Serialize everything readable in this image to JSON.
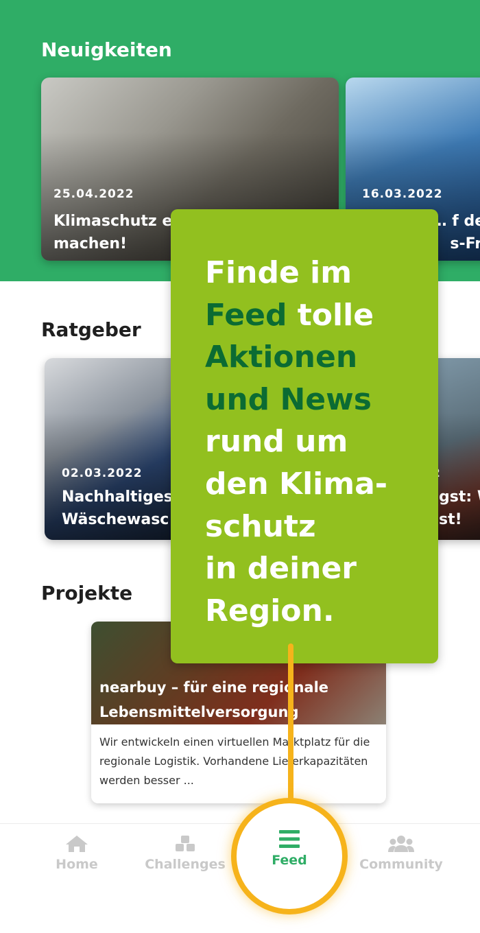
{
  "sections": {
    "news_title": "Neuigkeiten",
    "guide_title": "Ratgeber",
    "projects_title": "Projekte"
  },
  "news": [
    {
      "date": "25.04.2022",
      "headline_line1": "Klimaschutz e",
      "headline_line2": "machen!"
    },
    {
      "date": "16.03.2022",
      "headline_line1": "… f der",
      "headline_line2": "s-Fre"
    }
  ],
  "guide": [
    {
      "date": "02.03.2022",
      "headline_line1": "Nachhaltiges",
      "headline_line2": "Wäschewasc"
    },
    {
      "date": "2",
      "headline_line1": "gst: W",
      "headline_line2": "st!"
    }
  ],
  "project": {
    "title": "nearbuy – für eine regionale Lebensmittelversorgung",
    "description": "Wir entwickeln einen virtuellen Marktplatz für die regionale Logistik. Vorhandene Lieferkapazitäten werden besser ..."
  },
  "tooltip": {
    "line1": "Finde im",
    "feed_word": "Feed",
    "line2_rest": " tolle",
    "line3": "Aktionen",
    "line4": "und News",
    "line5": "rund um",
    "line6": "den Klima-",
    "line7": "schutz",
    "line8": "in deiner",
    "line9": "Region."
  },
  "nav": {
    "home": "Home",
    "challenges": "Challenges",
    "feed": "Feed",
    "community": "Community"
  },
  "icons": {
    "home": "home-icon",
    "challenges": "cubes-icon",
    "feed": "menu-icon",
    "community": "users-icon"
  },
  "colors": {
    "header_green": "#2fad66",
    "tooltip_green": "#92c01f",
    "highlight_green": "#0b6b33",
    "highlight_ring": "#f6b31b",
    "nav_inactive": "#c9c9c9"
  }
}
